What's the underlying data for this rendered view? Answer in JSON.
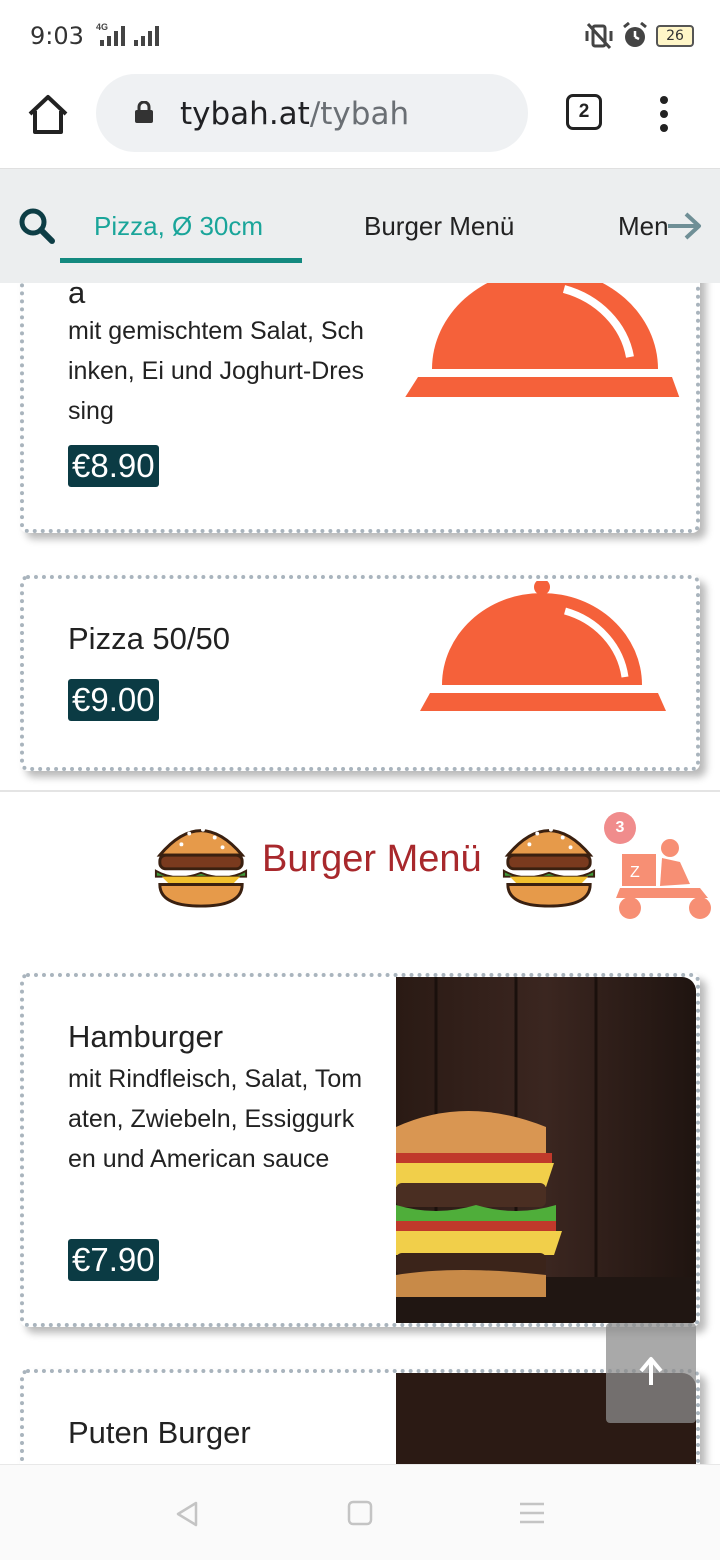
{
  "status_bar": {
    "time": "9:03",
    "network": "4G",
    "battery": "26",
    "icons": [
      "vibrate-off-icon",
      "alarm-icon",
      "battery-icon"
    ]
  },
  "browser": {
    "url_host": "tybah.at",
    "url_path": "/tybah",
    "tab_count": "2"
  },
  "category_nav": {
    "tabs": [
      {
        "label": "Pizza, Ø 30cm",
        "active": true
      },
      {
        "label": "Burger Menü",
        "active": false
      },
      {
        "label": "Men",
        "active": false
      }
    ]
  },
  "pizza_items": [
    {
      "title_fragment": "a",
      "description": "mit gemischtem Salat, Schinken, Ei und Joghurt-Dressing",
      "price": "€8.90"
    },
    {
      "title": "Pizza 50/50",
      "price": "€9.00"
    }
  ],
  "burger_section": {
    "title": "Burger Menü",
    "cart_count": "3"
  },
  "burger_items": [
    {
      "title": "Hamburger",
      "description": "mit Rindfleisch, Salat, Tomaten, Zwiebeln, Essiggurken und American sauce",
      "price": "€7.90"
    },
    {
      "title": "Puten Burger"
    }
  ],
  "colors": {
    "accent": "#1aa59a",
    "price_bg": "#0b3b44",
    "section_title": "#a8282c",
    "cloche": "#f5613a"
  }
}
